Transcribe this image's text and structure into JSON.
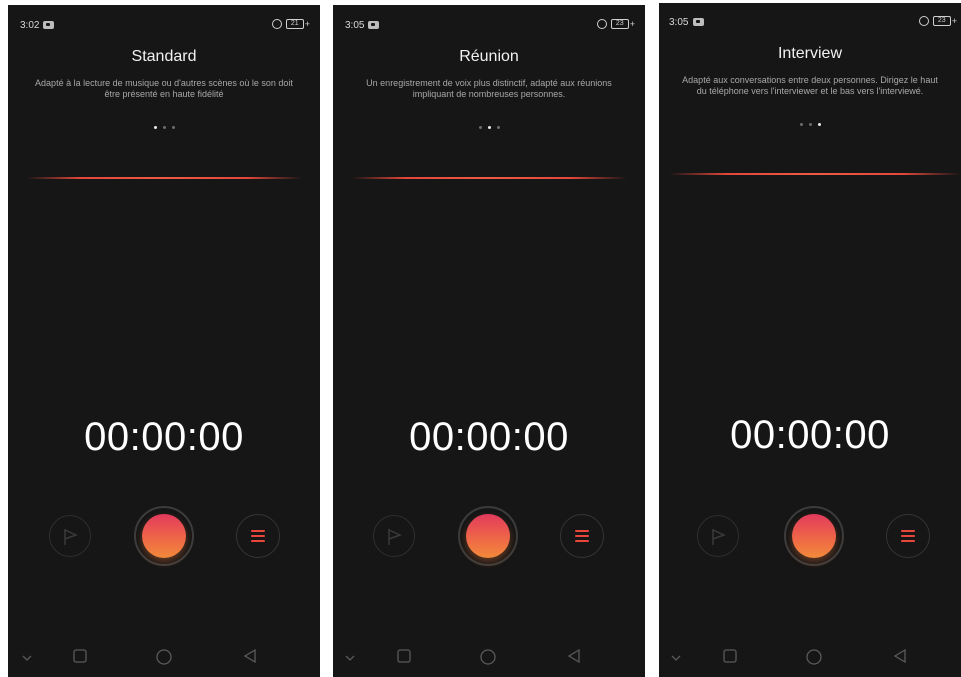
{
  "screens": [
    {
      "status_time": "3:02",
      "battery": "21",
      "mode_title": "Standard",
      "mode_desc": "Adapté à la lecture de musique ou d'autres scènes où le son doit être présenté en haute fidélité",
      "active_dot": 0,
      "timer": "00:00:00"
    },
    {
      "status_time": "3:05",
      "battery": "23",
      "mode_title": "Réunion",
      "mode_desc": "Un enregistrement de voix plus distinctif, adapté aux réunions impliquant de nombreuses personnes.",
      "active_dot": 1,
      "timer": "00:00:00"
    },
    {
      "status_time": "3:05",
      "battery": "23",
      "mode_title": "Interview",
      "mode_desc": "Adapté aux conversations entre deux personnes. Dirigez le haut du téléphone vers l'interviewer et le bas vers l'interviewé.",
      "active_dot": 2,
      "timer": "00:00:00"
    }
  ],
  "colors": {
    "background": "#161616",
    "accent_red": "#e8463d",
    "record_top": "#e23a5c",
    "record_bottom": "#f28a3a"
  },
  "icons": {
    "flag": "flag-icon",
    "menu": "menu-icon",
    "nav_down": "chevron-down-icon",
    "nav_recents": "square-icon",
    "nav_home": "circle-icon",
    "nav_back": "triangle-back-icon",
    "alarm": "alarm-icon",
    "notification": "notification-icon"
  }
}
